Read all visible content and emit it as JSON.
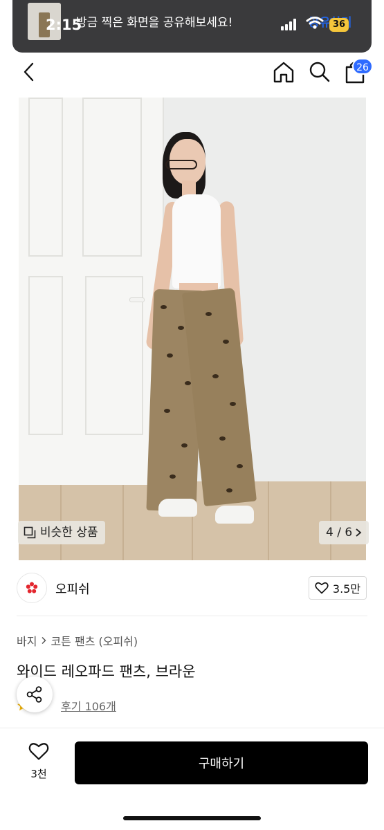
{
  "status_bar": {
    "time": "2:15",
    "battery": "36"
  },
  "banner": {
    "message": "방금 찍은 화면을 공유해보세요!",
    "action": "공유하기"
  },
  "header": {
    "cart_count": "26"
  },
  "gallery": {
    "similar_label": "비슷한 상품",
    "page_indicator": "4 / 6"
  },
  "brand": {
    "name": "오피쉬",
    "likes": "3.5만"
  },
  "breadcrumb": {
    "category": "바지",
    "subcategory": "코튼 팬츠 (오피쉬)"
  },
  "product": {
    "title": "와이드 레오파드 팬츠, 브라운",
    "review_label": "후기 106개"
  },
  "bottom_bar": {
    "wish_count": "3천",
    "buy_label": "구매하기"
  },
  "colors": {
    "accent": "#2f6bff",
    "buy_bg": "#000000",
    "brand_logo": "#e3262e"
  }
}
